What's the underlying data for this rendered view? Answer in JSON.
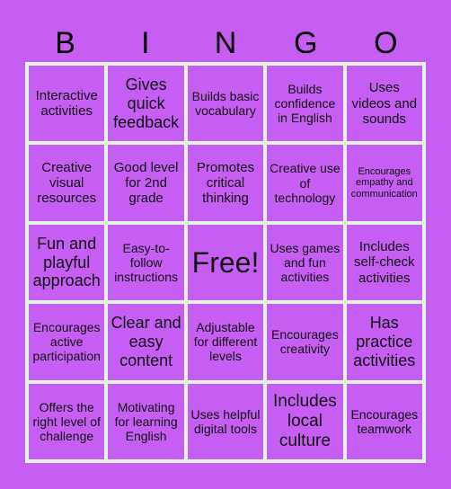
{
  "header": {
    "letters": [
      "B",
      "I",
      "N",
      "G",
      "O"
    ]
  },
  "card": {
    "colors": {
      "background": "#c65ef4",
      "cell": "#c65ef4",
      "border": "#e4f3e3",
      "text": "#111111"
    },
    "rows": [
      [
        "Interactive activities",
        "Gives quick feedback",
        "Builds basic vocabulary",
        "Builds confidence in English",
        "Uses videos and sounds"
      ],
      [
        "Creative visual resources",
        "Good level for 2nd grade",
        "Promotes critical thinking",
        "Creative use of technology",
        "Encourages empathy and communication"
      ],
      [
        "Fun and playful approach",
        "Easy-to-follow instructions",
        "Free!",
        "Uses games and fun activities",
        "Includes self-check activities"
      ],
      [
        "Encourages active participation",
        "Clear and easy content",
        "Adjustable for different levels",
        "Encourages creativity",
        "Has practice activities"
      ],
      [
        "Offers the right level of challenge",
        "Motivating for learning English",
        "Uses helpful digital tools",
        "Includes local culture",
        "Encourages teamwork"
      ]
    ]
  }
}
